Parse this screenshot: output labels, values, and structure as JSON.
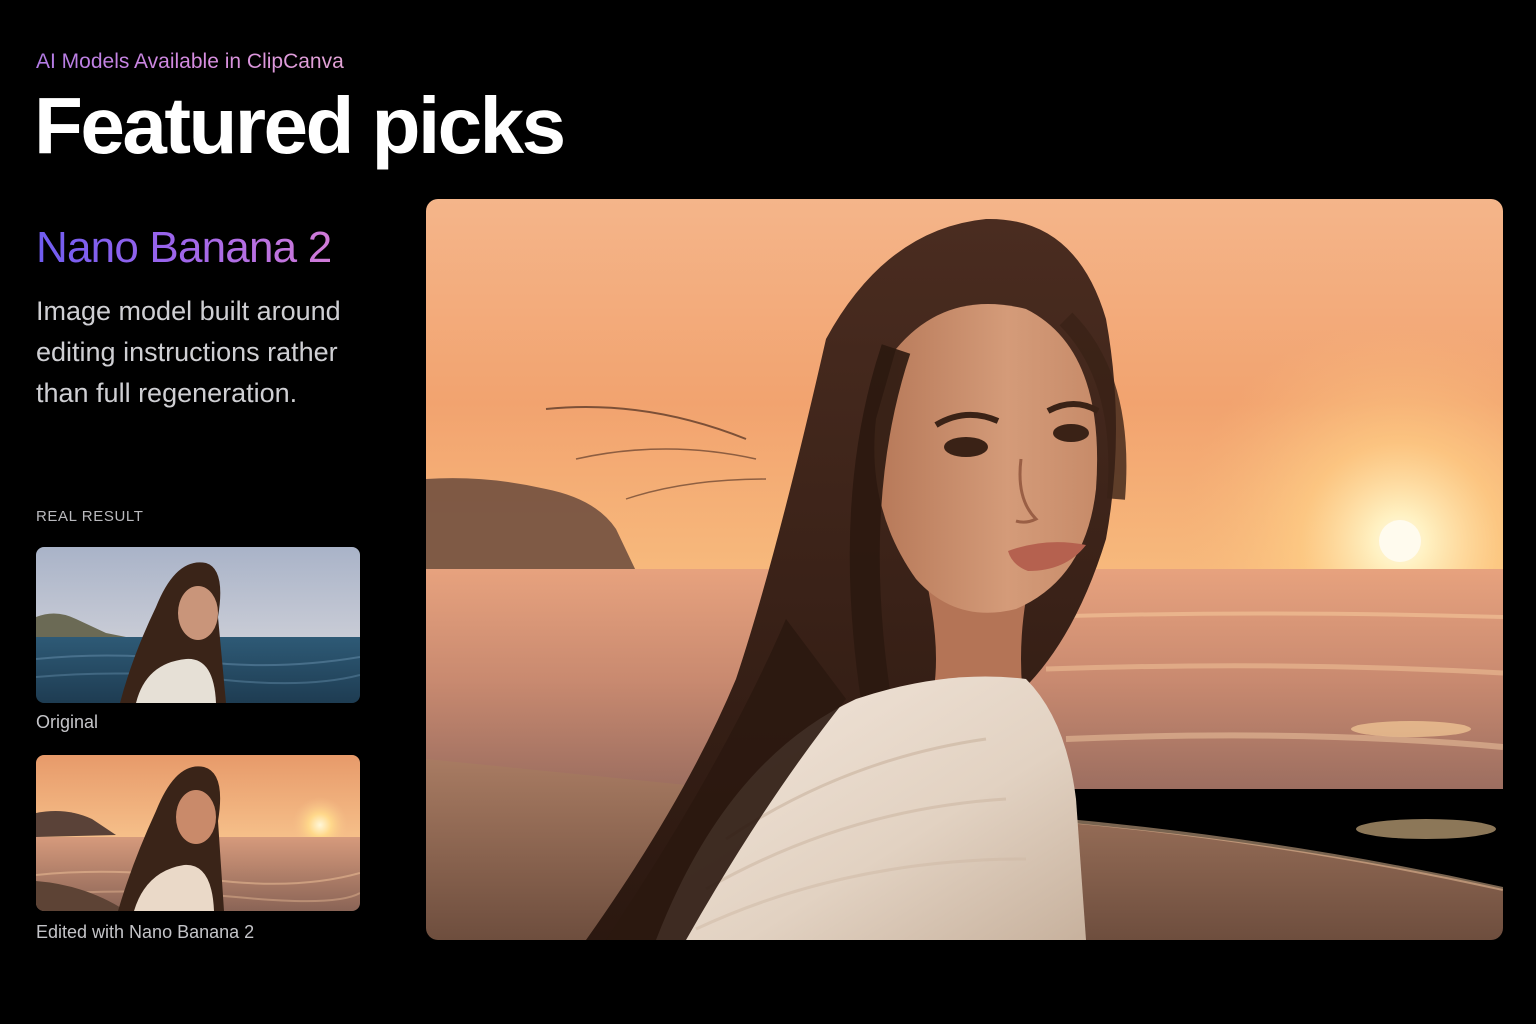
{
  "header": {
    "eyebrow": "AI Models Available in ClipCanva",
    "title": "Featured picks"
  },
  "feature": {
    "model_name": "Nano Banana 2",
    "description": "Image model built around editing instructions rather than full regeneration.",
    "result_label": "REAL RESULT",
    "original_caption": "Original",
    "edited_caption": "Edited with Nano Banana 2"
  },
  "colors": {
    "background": "#000000",
    "eyebrow_gradient": [
      "#b37be6",
      "#e3a4d6"
    ],
    "model_name_gradient": [
      "#6f5cf0",
      "#d17bd8"
    ]
  }
}
